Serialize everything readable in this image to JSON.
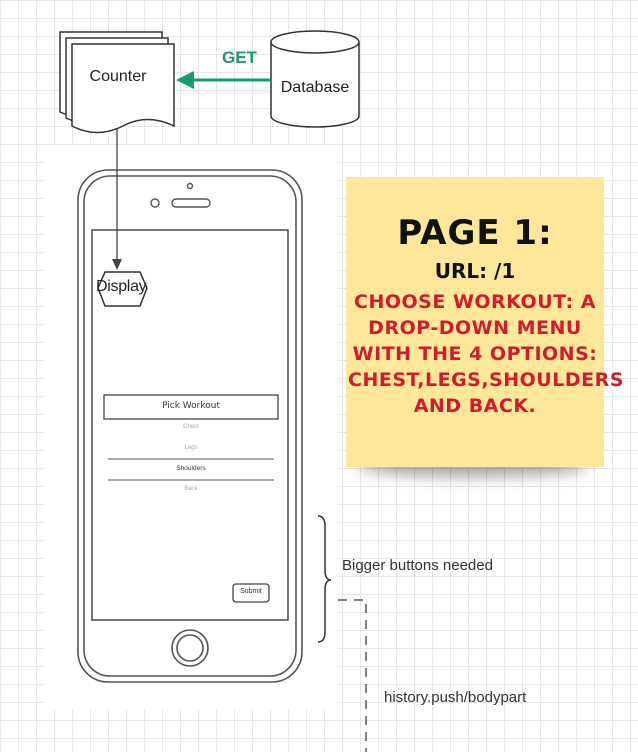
{
  "flow": {
    "counter_label": "Counter",
    "database_label": "Database",
    "get_label": "GET",
    "display_label": "Display"
  },
  "mockup": {
    "pick_workout": "Pick Workout",
    "options": [
      "Chest",
      "Legs",
      "Shoulders",
      "Back"
    ],
    "submit_label": "Submit"
  },
  "note": {
    "heading": "PAGE 1:",
    "url": "URL: /1",
    "description": "CHOOSE WORKOUT:  A DROP-DOWN MENU WITH THE 4 OPTIONS: CHEST,LEGS,SHOULDERS AND BACK."
  },
  "annotations": {
    "bigger_buttons": "Bigger buttons needed",
    "history_push": "history.push/bodypart"
  },
  "colors": {
    "get_arrow": "#1a9b6c",
    "note_background": "#fce79b",
    "note_text_red": "#d11d2b"
  }
}
